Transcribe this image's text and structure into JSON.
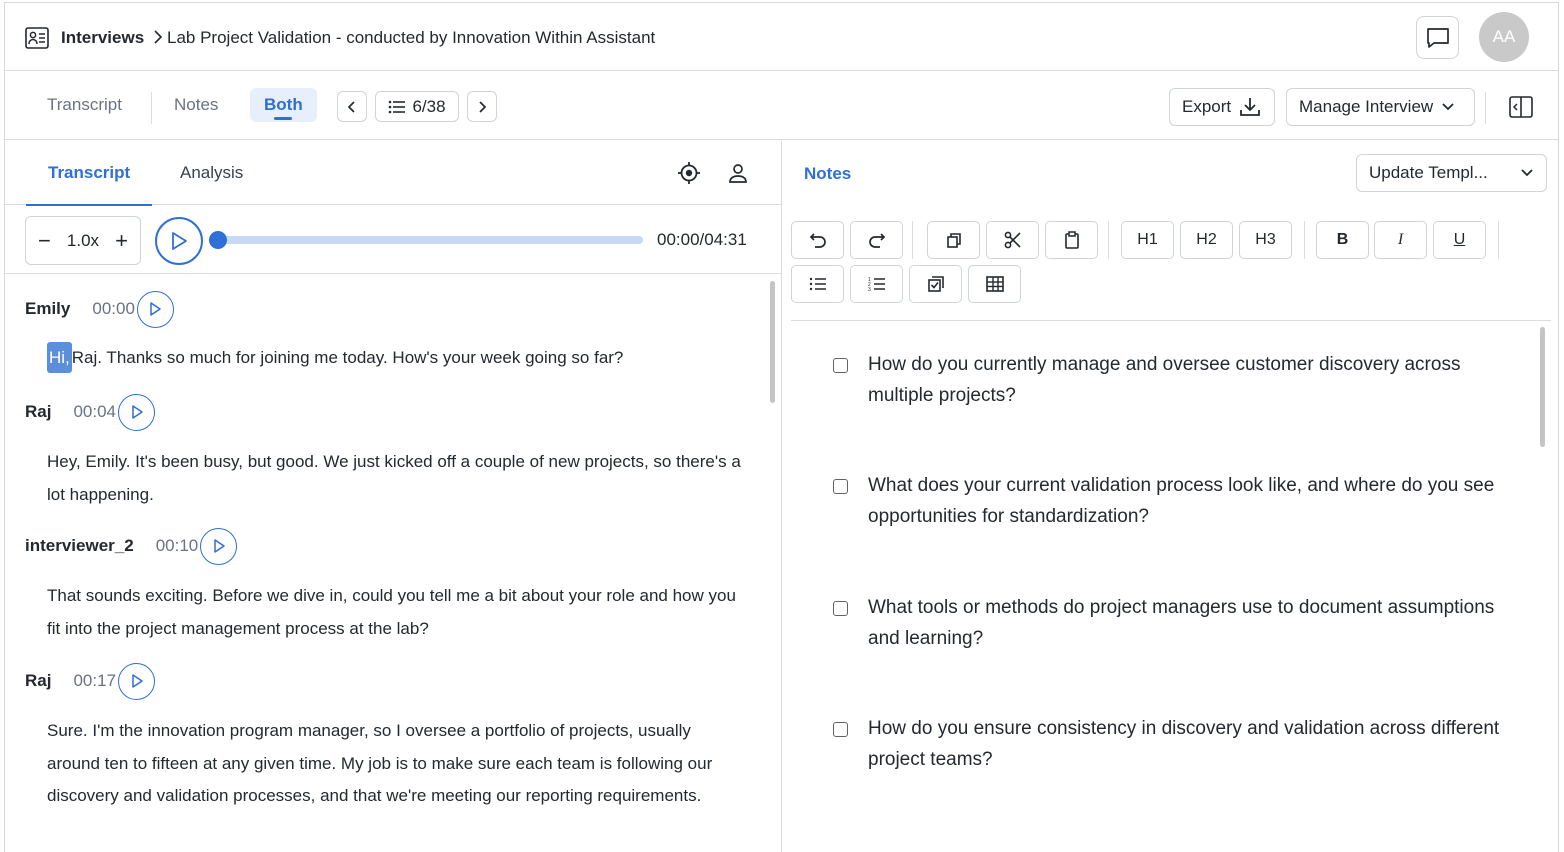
{
  "header": {
    "breadcrumb_root": "Interviews",
    "page_title": "Lab Project Validation - conducted by Innovation Within Assistant",
    "avatar_initials": "AA"
  },
  "view_tabs": [
    "Transcript",
    "Notes",
    "Both"
  ],
  "active_view": "Both",
  "pager": {
    "counter": "6/38"
  },
  "toolbar": {
    "export_label": "Export",
    "manage_label": "Manage Interview"
  },
  "left_tabs": [
    "Transcript",
    "Analysis"
  ],
  "player": {
    "speed": "1.0x",
    "time": "00:00/04:31",
    "progress": 0
  },
  "transcript": [
    {
      "speaker": "Emily",
      "time": "00:00",
      "highlight": "Hi,",
      "text": "Raj. Thanks so much for joining me today. How's your week going so far?"
    },
    {
      "speaker": "Raj",
      "time": "00:04",
      "highlight": "",
      "text": "Hey, Emily. It's been busy, but good. We just kicked off a couple of new projects, so there's a lot happening."
    },
    {
      "speaker": "interviewer_2",
      "time": "00:10",
      "highlight": "",
      "text": "That sounds exciting. Before we dive in, could you tell me a bit about your role and how you fit into the project management process at the lab?"
    },
    {
      "speaker": "Raj",
      "time": "00:17",
      "highlight": "",
      "text": "Sure. I'm the innovation program manager, so I oversee a portfolio of projects, usually around ten to fifteen at any given time. My job is to make sure each team is following our discovery and validation processes, and that we're meeting our reporting requirements."
    }
  ],
  "notes": {
    "title": "Notes",
    "template_label": "Update Templ...",
    "toolbar": {
      "h1": "H1",
      "h2": "H2",
      "h3": "H3",
      "bold": "B",
      "italic": "I",
      "underline": "U"
    },
    "questions": [
      "How do you currently manage and oversee customer discovery across multiple projects?",
      "What does your current validation process look like, and where do you see opportunities for standardization?",
      "What tools or methods do project managers use to document assumptions and learning?",
      "How do you ensure consistency in discovery and validation across different project teams?"
    ]
  },
  "colors": {
    "accent": "#2f6fd6",
    "highlight": "#5b8fdc",
    "track": "#c7daf5"
  }
}
